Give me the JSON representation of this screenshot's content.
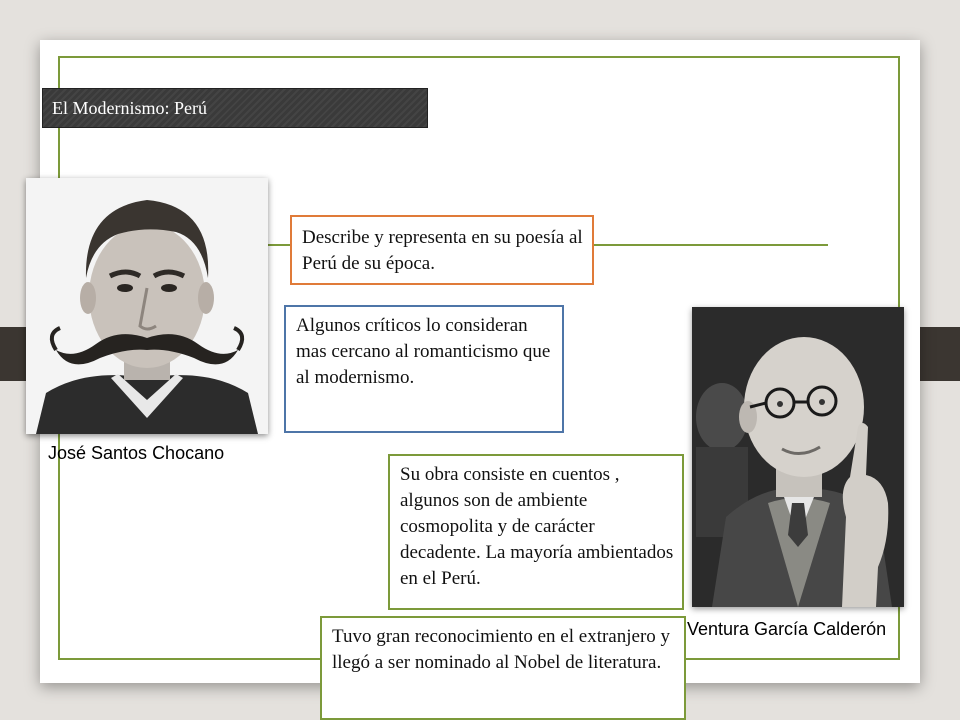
{
  "slide": {
    "title": "El Modernismo: Perú",
    "colors": {
      "frame": "#7c9a3a",
      "box_orange": "#e07b39",
      "box_blue": "#4e75a8",
      "title_bar": "#3a3a3a"
    }
  },
  "authors": [
    {
      "name": "José Santos Chocano"
    },
    {
      "name": "Ventura García Calderón"
    }
  ],
  "boxes": [
    {
      "text": "Describe y representa en su poesía al Perú de su época."
    },
    {
      "text": "Algunos críticos lo consideran mas cercano al romanticismo que al modernismo."
    },
    {
      "text": "Su obra consiste en cuentos , algunos son de ambiente cosmopolita y de carácter decadente. La mayoría ambientados en el Perú."
    },
    {
      "text": "Tuvo gran reconocimiento en el extranjero y llegó a ser nominado al Nobel de literatura."
    }
  ]
}
